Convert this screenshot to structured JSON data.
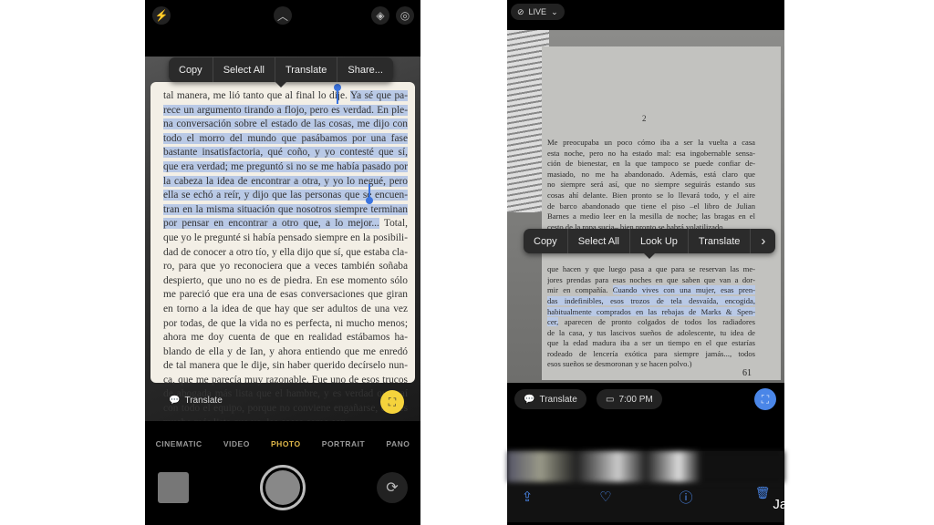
{
  "left_screen": {
    "top_icons": [
      "flash-icon",
      "chevron-up-icon",
      "live-text-icon",
      "live-photo-icon"
    ],
    "menu": [
      "Copy",
      "Select All",
      "Translate",
      "Share..."
    ],
    "lines": [
      {
        "b": "tal manera, me lió tanto que al final lo dije. ",
        "s": "Ya sé que pa-",
        "a": ""
      },
      {
        "b": "",
        "s": "rece un argumento tirando a flojo, pero es verdad. En ple-",
        "a": ""
      },
      {
        "b": "",
        "s": "na conversación sobre el estado de las cosas, me dijo con",
        "a": ""
      },
      {
        "b": "",
        "s": "todo el morro del mundo que pasábamos por una fase",
        "a": ""
      },
      {
        "b": "",
        "s": "bastante insatisfactoria, qué coño, y yo contesté que sí,",
        "a": ""
      },
      {
        "b": "",
        "s": "que era verdad; me preguntó si no se me había pasado por",
        "a": ""
      },
      {
        "b": "",
        "s": "la cabeza la idea de encontrar a otra, y yo lo negué, pero",
        "a": ""
      },
      {
        "b": "",
        "s": "ella se echó a reír, y dijo que las personas que se encuen-",
        "a": ""
      },
      {
        "b": "",
        "s": "tran en la misma situación que nosotros siempre terminan",
        "a": ""
      },
      {
        "b": "",
        "s": "por pensar en encontrar a otro que, a lo mejor...",
        "a": " Total,"
      },
      {
        "b": "que yo le pregunté si había pensado siempre en la posibili-",
        "s": "",
        "a": ""
      },
      {
        "b": "dad de conocer a otro tío, y ella dijo que sí, que estaba cla-",
        "s": "",
        "a": ""
      },
      {
        "b": "ro, para que yo reconociera que a veces también soñaba",
        "s": "",
        "a": ""
      },
      {
        "b": "despierto, que uno no es de piedra. En ese momento sólo",
        "s": "",
        "a": ""
      },
      {
        "b": "me pareció que era una de esas conversaciones que giran",
        "s": "",
        "a": ""
      },
      {
        "b": "en torno a la idea de que hay que ser adultos de una vez",
        "s": "",
        "a": ""
      },
      {
        "b": "por todas, de que la vida no es perfecta, ni mucho menos;",
        "s": "",
        "a": ""
      },
      {
        "b": "ahora me doy cuenta de que en realidad estábamos ha-",
        "s": "",
        "a": ""
      },
      {
        "b": "blando de ella y de Ian, y ahora entiendo que me enredó",
        "s": "",
        "a": ""
      },
      {
        "b": "de tal manera que le dije, sin haber querido decírselo nun-",
        "s": "",
        "a": ""
      },
      {
        "b": "ca, que me parecía muy razonable. Fue uno de esos trucos",
        "s": "",
        "a": ""
      },
      {
        "b": "de abogada más lista que el hambre, y es verdad que caí",
        "s": "",
        "a": ""
      },
      {
        "b": "con todo el equipo, porque no conviene engañarse, ella es",
        "s": "",
        "a": ""
      },
      {
        "b": "mucho más lista que yo, las cosas como son.",
        "s": "",
        "a": ""
      }
    ],
    "translate_label": "Translate",
    "modes": [
      "CINEMATIC",
      "VIDEO",
      "PHOTO",
      "PORTRAIT",
      "PANO"
    ],
    "active_mode": "PHOTO",
    "accent": "#f5d33c"
  },
  "right_screen": {
    "live_label": "LIVE",
    "page_header": "2",
    "menu": [
      "Copy",
      "Select All",
      "Look Up",
      "Translate"
    ],
    "lines": [
      {
        "b": "Me preocupaba un poco cómo iba a ser la vuelta a casa",
        "s": "",
        "a": ""
      },
      {
        "b": "esta noche, pero no ha estado mal: esa ingobernable sensa-",
        "s": "",
        "a": ""
      },
      {
        "b": "ción de bienestar, en la que tampoco se puede confiar de-",
        "s": "",
        "a": ""
      },
      {
        "b": "masiado, no me ha abandonado. Además, está claro que",
        "s": "",
        "a": ""
      },
      {
        "b": "no siempre será así, que no siempre seguirás estando sus",
        "s": "",
        "a": ""
      },
      {
        "b": "cosas ahí delante. Bien pronto se lo llevará todo, y el aire",
        "s": "",
        "a": ""
      },
      {
        "b": "de barco abandonado que tiene el piso –el libro de Julian",
        "s": "",
        "a": ""
      },
      {
        "b": "Barnes a medio leer en la mesilla de noche; las bragas en el",
        "s": "",
        "a": ""
      },
      {
        "b": "cesto de la ropa sucia– bien pronto se habrá volatilizado.",
        "s": "",
        "a": ""
      },
      {
        "b": "(A propósito: las bragas de las mujeres me supusieron una",
        "s": "",
        "a": ""
      },
      {
        "b": "sensible decepción en cuanto empecé a cohabitar con ellas.",
        "s": "",
        "a": ""
      },
      {
        "b": "",
        "s": "",
        "a": ""
      },
      {
        "b": "que hacen y que luego pasa a que para se reservan las me-",
        "s": "",
        "a": ""
      },
      {
        "b": "jores prendas para esas noches en que saben que van a dor-",
        "s": "",
        "a": ""
      },
      {
        "b": "mir en compañía. ",
        "s": "Cuando vives con una mujer, esas pren-",
        "a": ""
      },
      {
        "b": "",
        "s": "das indefinibles, esos trozos de tela desvaída, encogida,",
        "a": ""
      },
      {
        "b": "",
        "s": "habitualmente comprados en las rebajas de Marks & Spen-",
        "a": ""
      },
      {
        "b": "",
        "s": "cer,",
        "a": " aparecen de pronto colgados de todos los radiadores"
      },
      {
        "b": "de la casa, y tus lascivos sueños de adolescente, tu idea de",
        "s": "",
        "a": ""
      },
      {
        "b": "que la edad madura iba a ser un tiempo en el que estarías",
        "s": "",
        "a": ""
      },
      {
        "b": "rodeado de lencería exótica para siempre jamás..., todos",
        "s": "",
        "a": ""
      },
      {
        "b": "esos sueños se desmoronan y se hacen polvo.)",
        "s": "",
        "a": ""
      }
    ],
    "page_number": "61",
    "translate_label": "Translate",
    "time_label": "7:00 PM",
    "toolbar_icons": [
      "share-icon",
      "heart-icon",
      "info-icon",
      "trash-icon"
    ],
    "accent": "#4a86e8"
  },
  "credit": "Jam Kotenko/SlashGear"
}
